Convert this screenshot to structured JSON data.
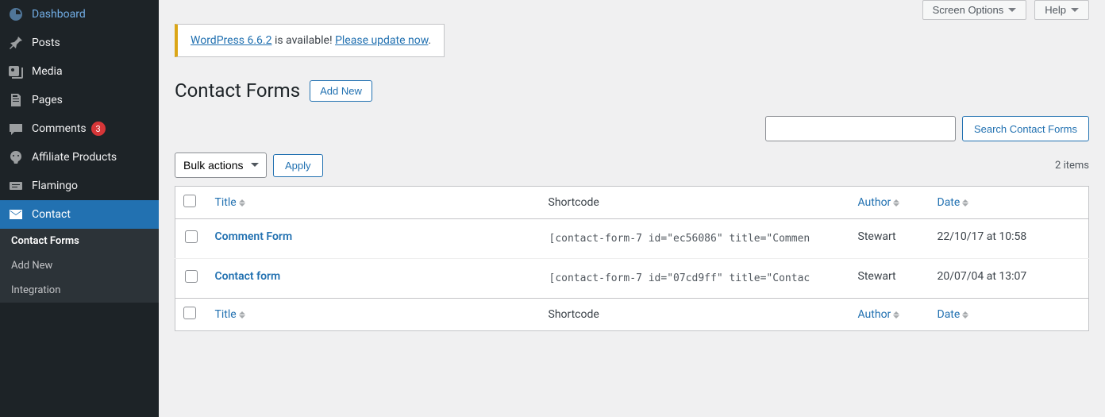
{
  "sidebar": {
    "items": [
      {
        "label": "Dashboard",
        "icon": "dashboard"
      },
      {
        "label": "Posts",
        "icon": "pin"
      },
      {
        "label": "Media",
        "icon": "media"
      },
      {
        "label": "Pages",
        "icon": "pages"
      },
      {
        "label": "Comments",
        "icon": "comment",
        "badge": "3"
      },
      {
        "label": "Affiliate Products",
        "icon": "affiliate"
      },
      {
        "label": "Flamingo",
        "icon": "flamingo"
      },
      {
        "label": "Contact",
        "icon": "mail",
        "active": true
      }
    ],
    "sub": [
      {
        "label": "Contact Forms",
        "current": true
      },
      {
        "label": "Add New"
      },
      {
        "label": "Integration"
      }
    ]
  },
  "topright": {
    "screen_options": "Screen Options",
    "help": "Help"
  },
  "notice": {
    "link1": "WordPress 6.6.2",
    "text_mid": " is available! ",
    "link2": "Please update now",
    "text_end": "."
  },
  "heading": {
    "title": "Contact Forms",
    "add_new": "Add New"
  },
  "search": {
    "button": "Search Contact Forms"
  },
  "bulk": {
    "select_label": "Bulk actions",
    "apply": "Apply",
    "items_count": "2 items"
  },
  "table": {
    "headers": {
      "title": "Title",
      "shortcode": "Shortcode",
      "author": "Author",
      "date": "Date"
    },
    "rows": [
      {
        "title": "Comment Form",
        "shortcode": "[contact-form-7 id=\"ec56086\" title=\"Commen",
        "author": "Stewart",
        "date": "22/10/17 at 10:58"
      },
      {
        "title": "Contact form",
        "shortcode": "[contact-form-7 id=\"07cd9ff\" title=\"Contac",
        "author": "Stewart",
        "date": "20/07/04 at 13:07"
      }
    ]
  }
}
